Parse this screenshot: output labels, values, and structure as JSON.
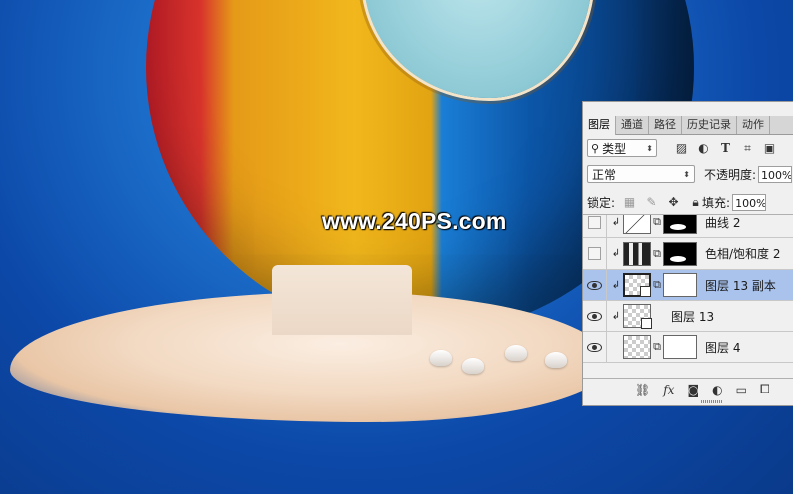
{
  "watermark": "www.240PS.com",
  "panel": {
    "tabs": [
      {
        "label": "图层",
        "active": true
      },
      {
        "label": "通道",
        "active": false
      },
      {
        "label": "路径",
        "active": false
      },
      {
        "label": "历史记录",
        "active": false
      },
      {
        "label": "动作",
        "active": false
      }
    ],
    "filter": {
      "kind_label": "类型",
      "icons": [
        "image-filter-icon",
        "adjustment-filter-icon",
        "text-filter-icon",
        "shape-filter-icon",
        "smart-object-filter-icon"
      ]
    },
    "blend_mode": "正常",
    "opacity_label": "不透明度:",
    "opacity_value": "100%",
    "lock_label": "锁定:",
    "fill_label": "填充:",
    "fill_value": "100%",
    "layers": [
      {
        "name": "曲线 2",
        "visible": false,
        "selected": false,
        "clipped": true,
        "thumb": "curves",
        "mask": "black"
      },
      {
        "name": "色相/饱和度 2",
        "visible": false,
        "selected": false,
        "clipped": true,
        "thumb": "hue",
        "mask": "black"
      },
      {
        "name": "图层 13 副本",
        "visible": true,
        "selected": true,
        "clipped": true,
        "thumb": "smart",
        "mask": "white"
      },
      {
        "name": "图层 13",
        "visible": true,
        "selected": false,
        "clipped": true,
        "thumb": "smart",
        "mask": null
      },
      {
        "name": "图层 4",
        "visible": true,
        "selected": false,
        "clipped": false,
        "thumb": "checker",
        "mask": "white"
      }
    ],
    "footer_icons": [
      "link-layers-icon",
      "fx-icon",
      "add-mask-icon",
      "adjustment-layer-icon",
      "new-group-icon",
      "new-layer-icon"
    ],
    "footer_fx": "fx"
  }
}
